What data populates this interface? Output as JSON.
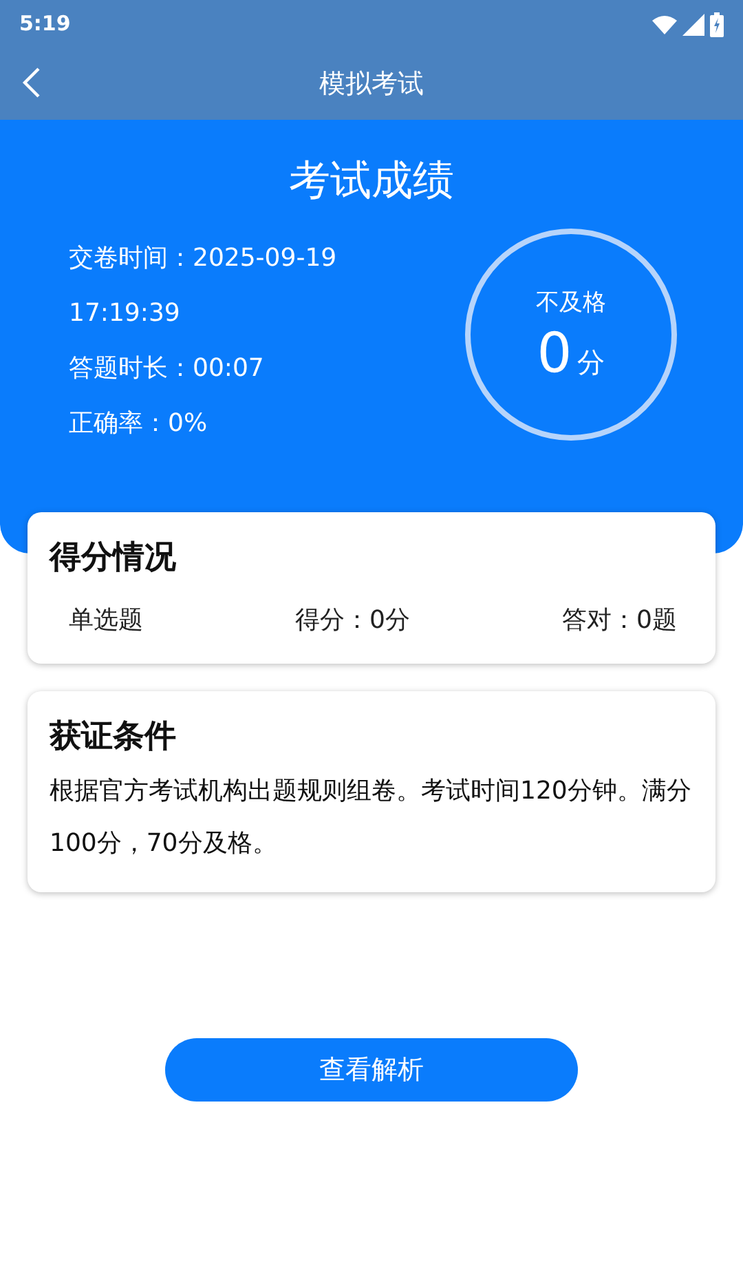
{
  "status_bar": {
    "time": "5:19"
  },
  "app_bar": {
    "title": "模拟考试"
  },
  "result": {
    "title": "考试成绩",
    "submit_time": "交卷时间：2025-09-19 17:19:39",
    "duration": "答题时长：00:07",
    "accuracy": "正确率：0%",
    "verdict": "不及格",
    "score": "0",
    "score_unit": "分"
  },
  "score_card": {
    "title": "得分情况",
    "rows": [
      {
        "type": "单选题",
        "score": "得分：0分",
        "correct": "答对：0题"
      }
    ]
  },
  "condition_card": {
    "title": "获证条件",
    "text": "根据官方考试机构出题规则组卷。考试时间120分钟。满分100分，70分及格。"
  },
  "button": "查看解析"
}
